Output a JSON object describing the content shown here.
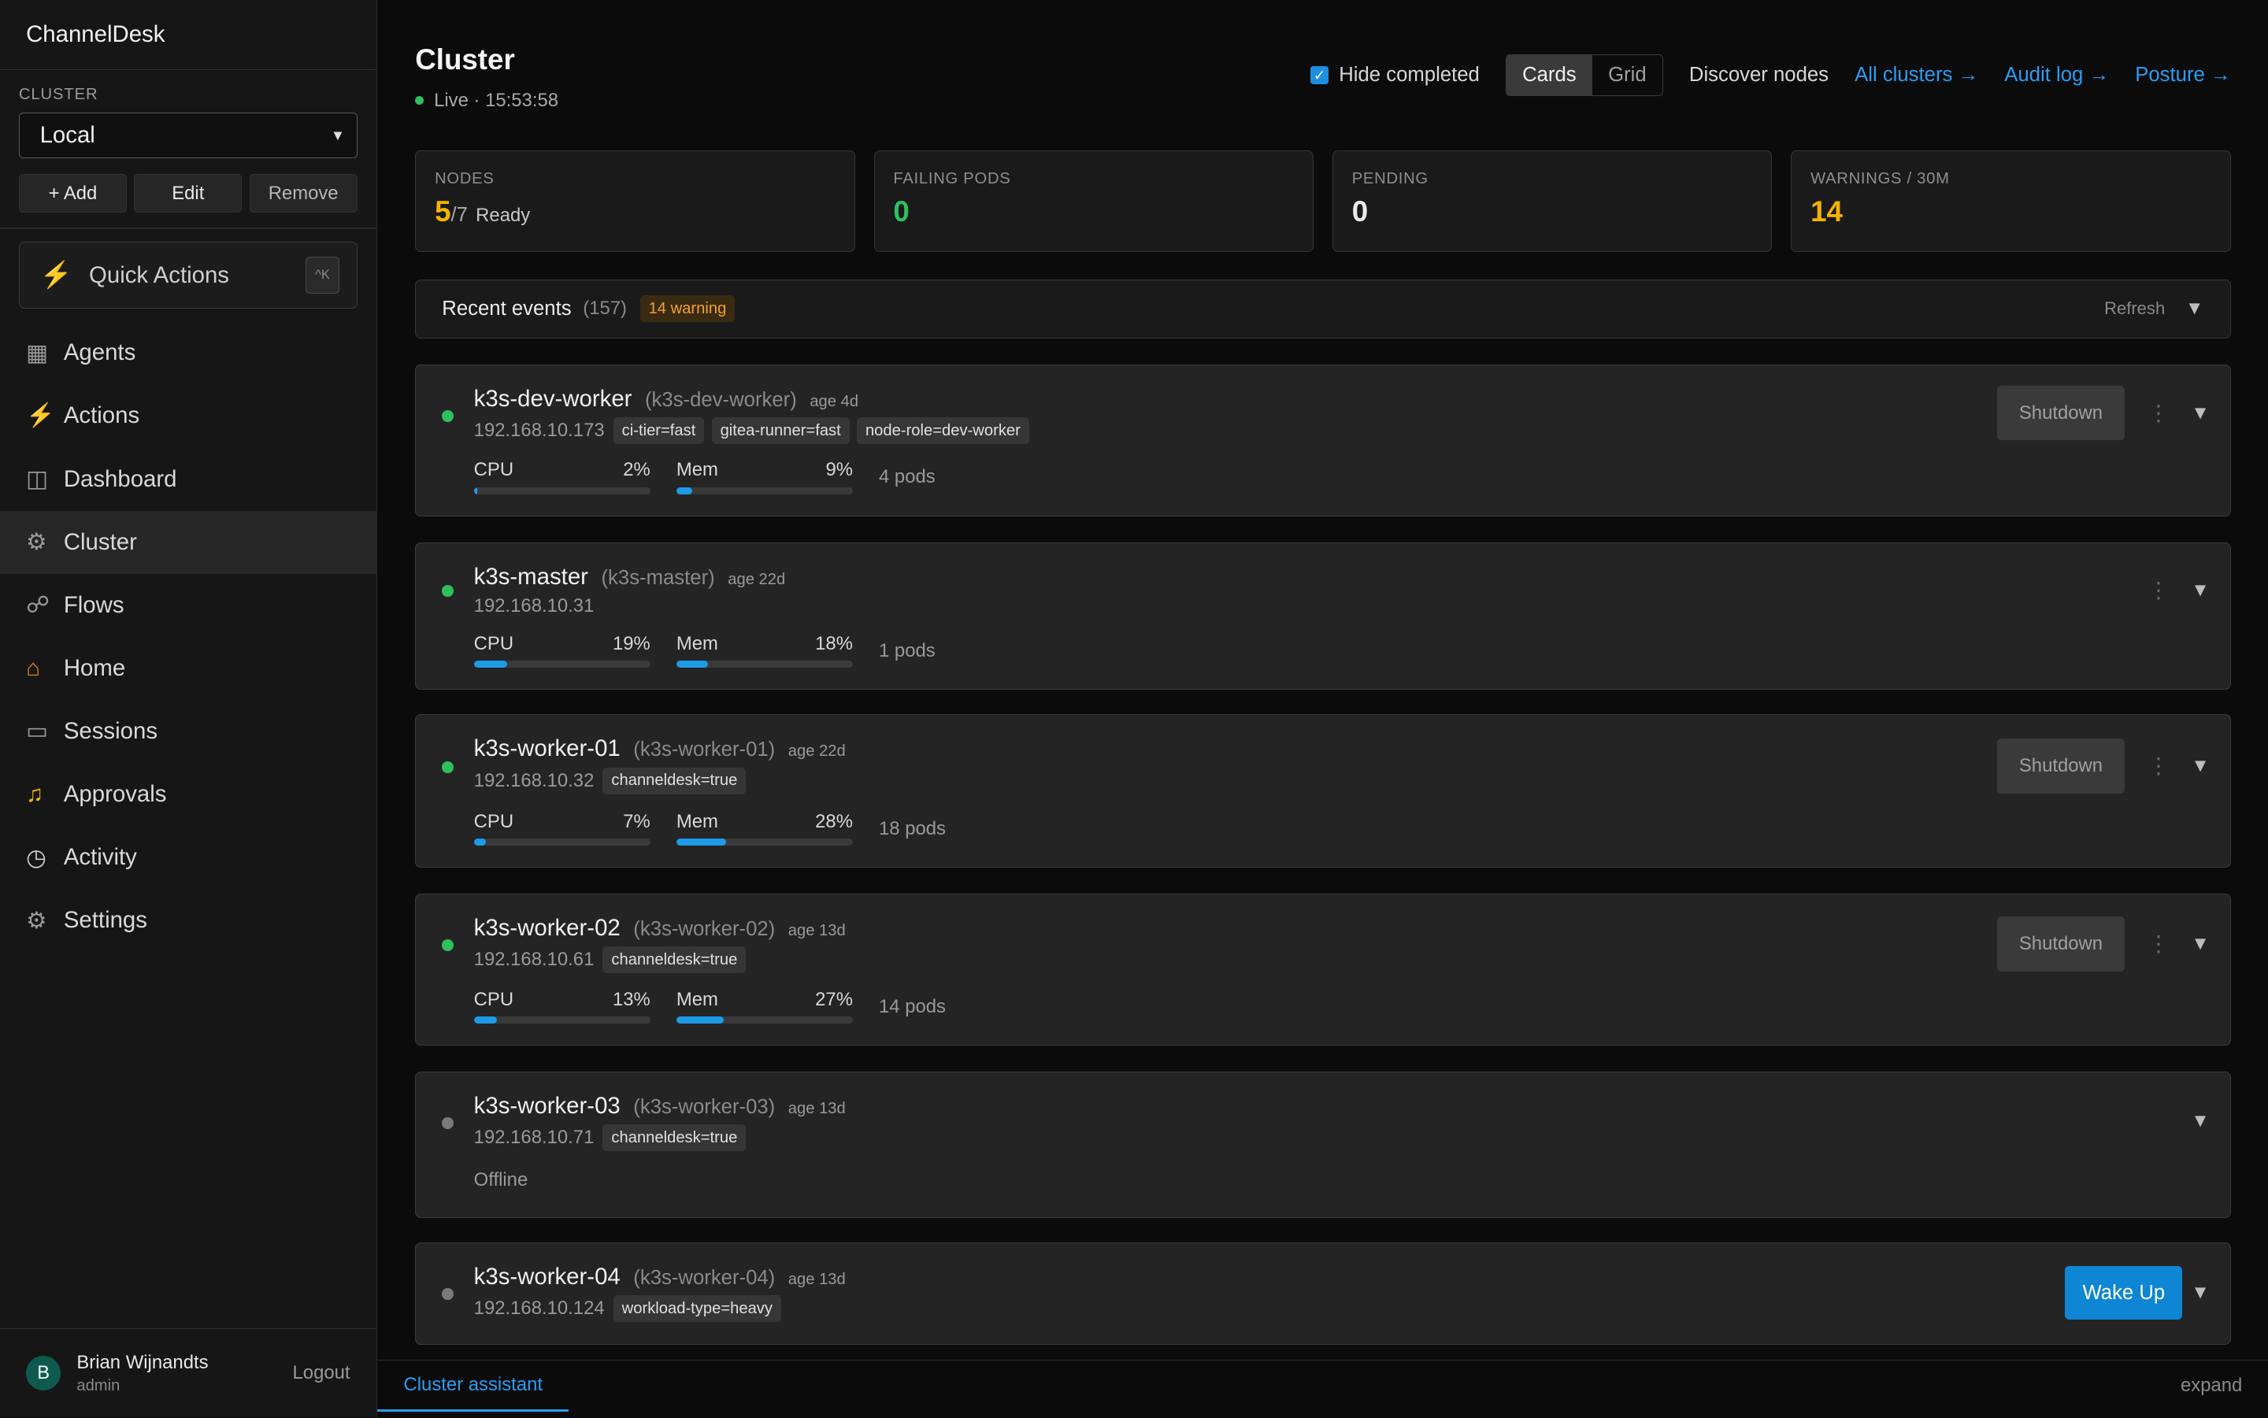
{
  "app": {
    "brand": "ChannelDesk"
  },
  "sidebar": {
    "cluster_label": "CLUSTER",
    "cluster_selected": "Local",
    "buttons": {
      "add": "+ Add",
      "edit": "Edit",
      "remove": "Remove"
    },
    "quick_actions": {
      "label": "Quick Actions",
      "shortcut": "^K"
    },
    "nav": [
      {
        "label": "Agents",
        "icon": "grid-icon"
      },
      {
        "label": "Actions",
        "icon": "bolt-icon"
      },
      {
        "label": "Dashboard",
        "icon": "columns-icon"
      },
      {
        "label": "Cluster",
        "icon": "gear-icon",
        "active": true
      },
      {
        "label": "Flows",
        "icon": "flow-icon"
      },
      {
        "label": "Home",
        "icon": "house-icon"
      },
      {
        "label": "Sessions",
        "icon": "terminal-icon"
      },
      {
        "label": "Approvals",
        "icon": "bell-icon"
      },
      {
        "label": "Activity",
        "icon": "clock-icon"
      },
      {
        "label": "Settings",
        "icon": "gear-icon"
      }
    ],
    "user": {
      "initial": "B",
      "name": "Brian Wijnandts",
      "role": "admin",
      "logout": "Logout"
    }
  },
  "header": {
    "title": "Cluster",
    "live": "Live · 15:53:58",
    "hide_completed": "Hide completed",
    "view_cards": "Cards",
    "view_grid": "Grid",
    "discover": "Discover nodes",
    "links": {
      "all_clusters": "All clusters →",
      "audit_log": "Audit log →",
      "posture": "Posture →"
    }
  },
  "stats": {
    "nodes": {
      "label": "NODES",
      "ready": "5",
      "total": "/7",
      "suffix": "Ready"
    },
    "failing": {
      "label": "FAILING PODS",
      "value": "0"
    },
    "pending": {
      "label": "PENDING",
      "value": "0"
    },
    "warnings": {
      "label": "WARNINGS / 30M",
      "value": "14"
    }
  },
  "events": {
    "title": "Recent events",
    "count": "(157)",
    "warning": "14 warning",
    "refresh": "Refresh"
  },
  "nodes": [
    {
      "name": "k3s-dev-worker",
      "id": "(k3s-dev-worker)",
      "age": "age 4d",
      "ip": "192.168.10.173",
      "tags": [
        "ci-tier=fast",
        "gitea-runner=fast",
        "node-role=dev-worker"
      ],
      "cpu_label": "CPU",
      "cpu": "2%",
      "cpu_frac": 0.02,
      "mem_label": "Mem",
      "mem": "9%",
      "mem_frac": 0.09,
      "pods": "4 pods",
      "action": "Shutdown"
    },
    {
      "name": "k3s-master",
      "id": "(k3s-master)",
      "age": "age 22d",
      "ip": "192.168.10.31",
      "tags": [],
      "cpu_label": "CPU",
      "cpu": "19%",
      "cpu_frac": 0.19,
      "mem_label": "Mem",
      "mem": "18%",
      "mem_frac": 0.18,
      "pods": "1 pods"
    },
    {
      "name": "k3s-worker-01",
      "id": "(k3s-worker-01)",
      "age": "age 22d",
      "ip": "192.168.10.32",
      "tags": [
        "channeldesk=true"
      ],
      "cpu_label": "CPU",
      "cpu": "7%",
      "cpu_frac": 0.07,
      "mem_label": "Mem",
      "mem": "28%",
      "mem_frac": 0.28,
      "pods": "18 pods",
      "action": "Shutdown"
    },
    {
      "name": "k3s-worker-02",
      "id": "(k3s-worker-02)",
      "age": "age 13d",
      "ip": "192.168.10.61",
      "tags": [
        "channeldesk=true"
      ],
      "cpu_label": "CPU",
      "cpu": "13%",
      "cpu_frac": 0.13,
      "mem_label": "Mem",
      "mem": "27%",
      "mem_frac": 0.27,
      "pods": "14 pods",
      "action": "Shutdown"
    },
    {
      "name": "k3s-worker-03",
      "id": "(k3s-worker-03)",
      "age": "age 13d",
      "ip": "192.168.10.71",
      "tags": [
        "channeldesk=true"
      ],
      "status": "Offline"
    },
    {
      "name": "k3s-worker-04",
      "id": "(k3s-worker-04)",
      "age": "age 13d",
      "ip": "192.168.10.124",
      "tags": [
        "workload-type=heavy"
      ],
      "action": "Wake Up"
    }
  ],
  "assistant": {
    "tab": "Cluster assistant",
    "expand": "expand"
  },
  "colors": {
    "accent": "#2a9df4",
    "ok": "#2fbf5f",
    "warn": "#f4b400",
    "bar": "#1d9be8"
  }
}
